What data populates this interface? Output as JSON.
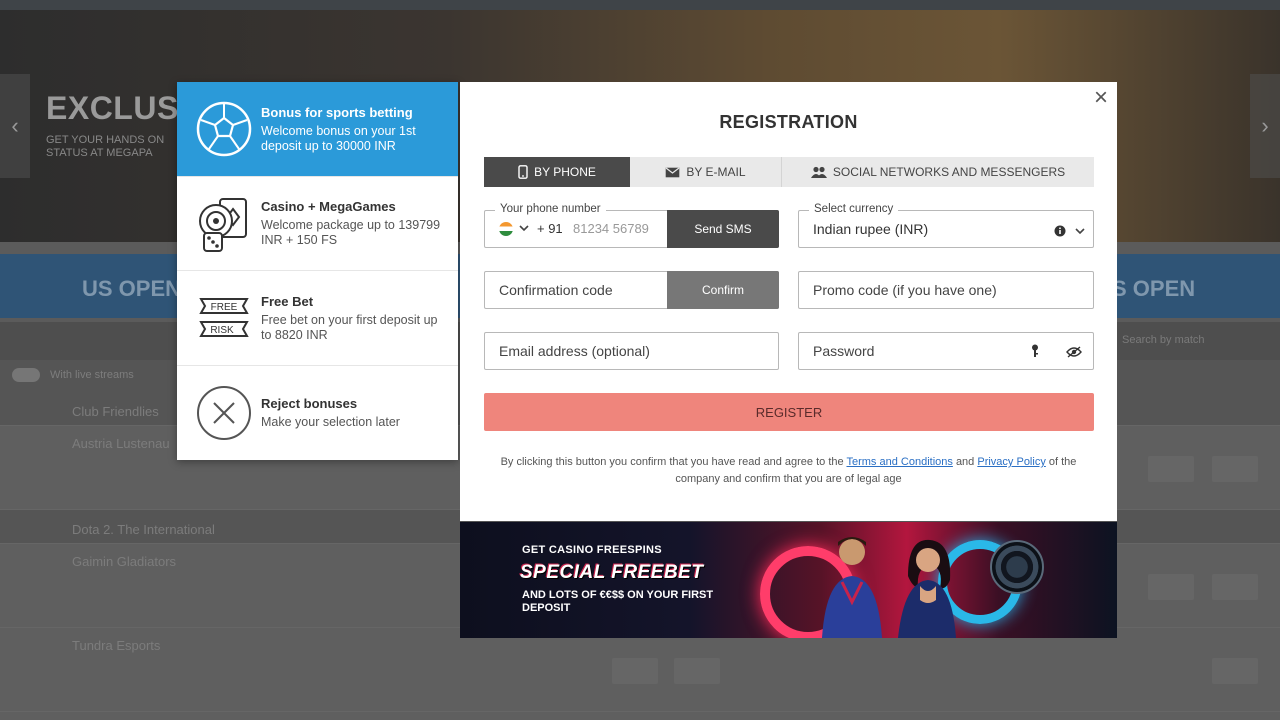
{
  "background": {
    "hero_title": "EXCLUSI",
    "hero_subtitle_1": "GET YOUR HANDS ON",
    "hero_subtitle_2": "STATUS AT MEGAPA",
    "banner_left": "US OPEN",
    "banner_right": "S OPEN",
    "search_placeholder": "Search by match",
    "filter_label": "With live streams",
    "rows": [
      {
        "label": "Club Friendlies",
        "type": "cat"
      },
      {
        "label": "Austria Lustenau",
        "type": "match"
      },
      {
        "label": "Dota 2. The International",
        "type": "cat"
      },
      {
        "label": "Gaimin Gladiators",
        "type": "match"
      },
      {
        "label": "Tundra Esports",
        "type": "match"
      }
    ]
  },
  "bonuses": [
    {
      "title": "Bonus for sports betting",
      "desc": "Welcome bonus on your 1st deposit up to 30000 INR",
      "icon": "soccer-ball-icon"
    },
    {
      "title": "Casino + MegaGames",
      "desc": "Welcome package up to 139799 INR + 150 FS",
      "icon": "casino-chip-icon"
    },
    {
      "title": "Free Bet",
      "desc": "Free bet on your first deposit up to 8820 INR",
      "icon": "free-risk-icon",
      "badge_top": "FREE",
      "badge_bottom": "RISK"
    },
    {
      "title": "Reject bonuses",
      "desc": "Make your selection later",
      "icon": "reject-icon"
    }
  ],
  "modal": {
    "close": "×",
    "title": "REGISTRATION",
    "tabs": [
      {
        "label": "BY PHONE",
        "icon": "phone-icon"
      },
      {
        "label": "BY E-MAIL",
        "icon": "envelope-icon"
      },
      {
        "label": "SOCIAL NETWORKS AND MESSENGERS",
        "icon": "users-icon"
      }
    ],
    "phone": {
      "label": "Your phone number",
      "country_code": "+ 91",
      "placeholder": "81234 56789",
      "send_sms": "Send SMS"
    },
    "currency": {
      "label": "Select currency",
      "value": "Indian rupee (INR)"
    },
    "confirmation": {
      "placeholder": "Confirmation code",
      "confirm": "Confirm"
    },
    "promo_placeholder": "Promo code (if you have one)",
    "email_placeholder": "Email address (optional)",
    "password_placeholder": "Password",
    "register": "REGISTER",
    "legal": {
      "before": "By clicking this button you confirm that you have read and agree to the",
      "terms": "Terms and Conditions",
      "and": "and",
      "privacy": "Privacy Policy",
      "after": "of the company and confirm that you are of legal age"
    }
  },
  "promo_banner": {
    "line1": "GET CASINO FREESPINS",
    "line2": "SPECIAL FREEBET",
    "line3": "AND LOTS OF €€$$ ON YOUR FIRST DEPOSIT"
  },
  "colors": {
    "accent_blue": "#2b9ad9",
    "tab_active": "#4a4a4a",
    "register_button": "#ef857c",
    "link": "#2a6fc4"
  }
}
